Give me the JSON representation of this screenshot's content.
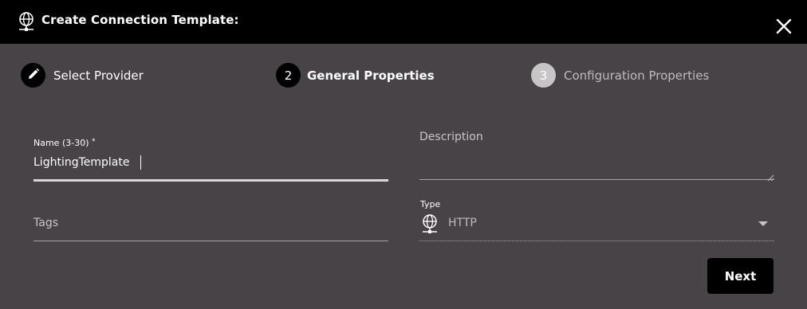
{
  "dialog": {
    "title": "Create Connection Template:",
    "title_icon": "globe-network-icon",
    "close_icon": "close-icon"
  },
  "stepper": {
    "steps": [
      {
        "marker": "pencil-icon",
        "label": "Select Provider",
        "state": "completed"
      },
      {
        "marker": "2",
        "label": "General Properties",
        "state": "active"
      },
      {
        "marker": "3",
        "label": "Configuration Properties",
        "state": "pending"
      }
    ]
  },
  "form": {
    "name": {
      "label": "Name (3-30)",
      "required_mark": "*",
      "value": "LightingTemplate"
    },
    "description": {
      "label": "Description",
      "value": ""
    },
    "tags": {
      "label": "Tags",
      "value": ""
    },
    "type": {
      "label": "Type",
      "value": "HTTP",
      "icon": "globe-network-icon"
    }
  },
  "actions": {
    "next_label": "Next"
  },
  "colors": {
    "title_bar": "#000000",
    "dialog_bg": "#474346",
    "text": "#ffffff",
    "muted_text": "#c8c6c7",
    "pending_step": "#c7c5c6"
  }
}
